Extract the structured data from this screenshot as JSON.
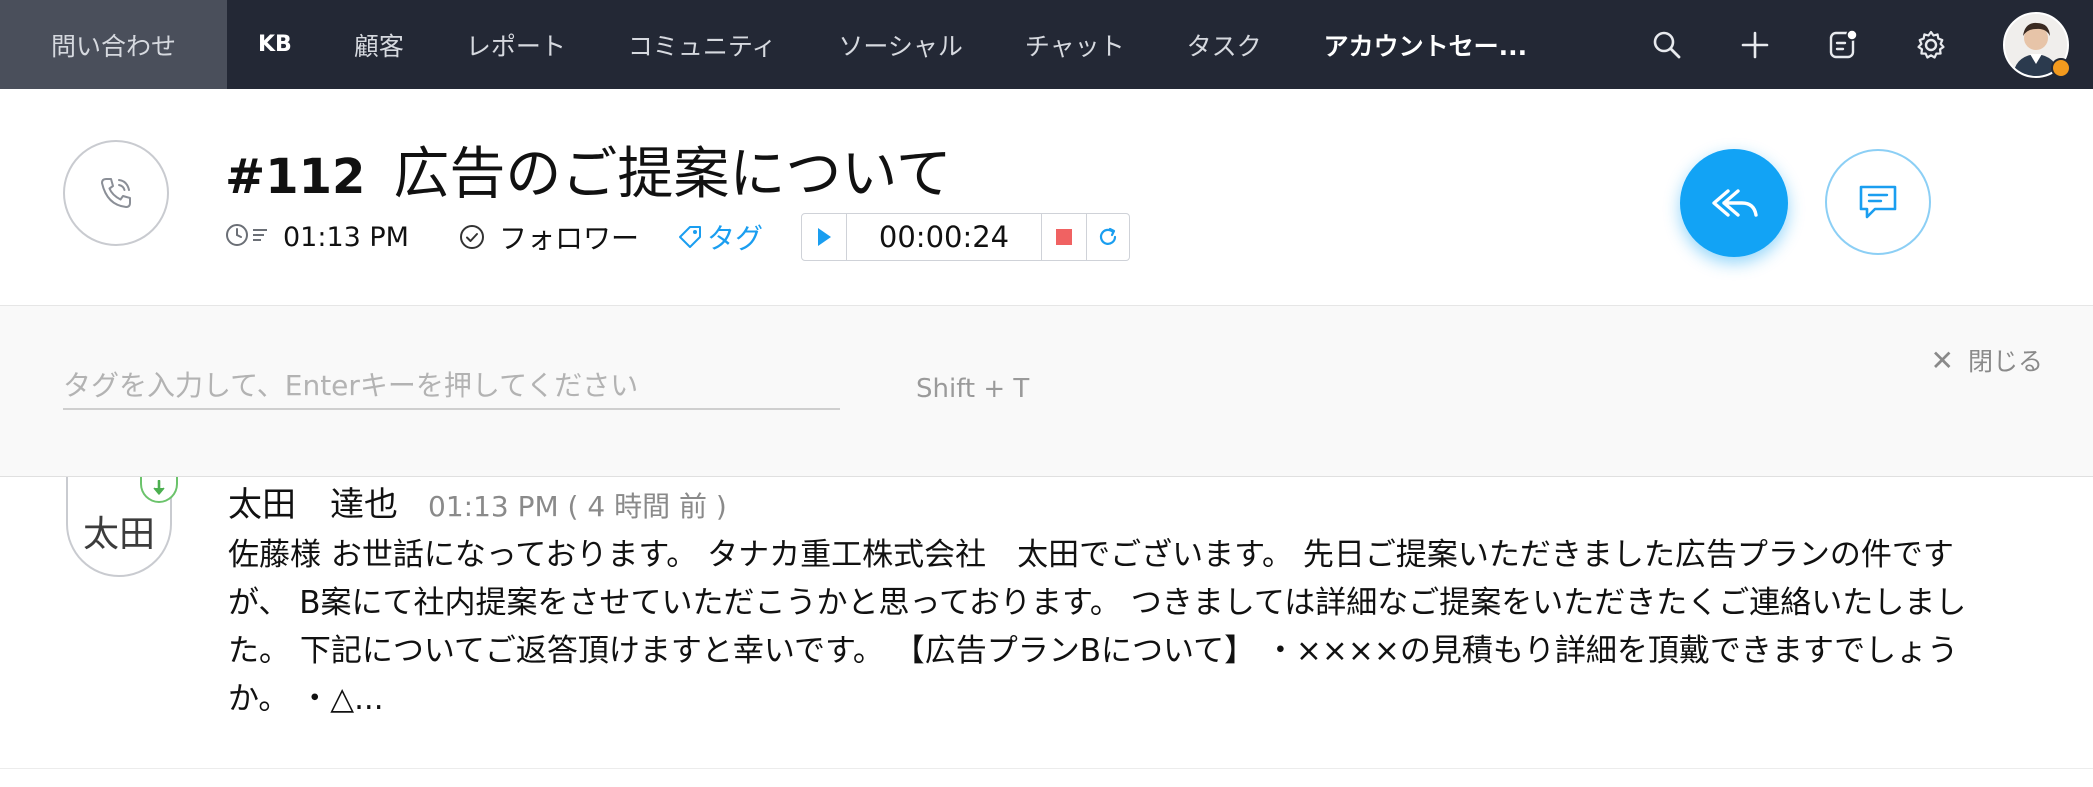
{
  "nav": {
    "items": [
      {
        "label": "問い合わせ",
        "active": true
      },
      {
        "label": "KB"
      },
      {
        "label": "顧客"
      },
      {
        "label": "レポート"
      },
      {
        "label": "コミュニティ"
      },
      {
        "label": "ソーシャル"
      },
      {
        "label": "チャット"
      },
      {
        "label": "タスク"
      },
      {
        "label": "アカウントセー..."
      }
    ],
    "icons": [
      "search-icon",
      "plus-icon",
      "notification-icon",
      "gear-icon"
    ],
    "status_color": "#f39a1e"
  },
  "ticket": {
    "number": "#112",
    "title": "広告のご提案について",
    "time": "01:13 PM",
    "follower_label": "フォロワー",
    "tag_label": "タグ",
    "timer": "00:00:24"
  },
  "tagbar": {
    "placeholder": "タグを入力して、Enterキーを押してください",
    "shortcut": "Shift + T",
    "close_label": "閉じる"
  },
  "thread": {
    "avatar_text": "太田",
    "sender": "太田　達也",
    "time": "01:13 PM ( 4 時間 前 )",
    "body": "佐藤様 お世話になっております。 タナカ重工株式会社　太田でございます。 先日ご提案いただきました広告プランの件ですが、 B案にて社内提案をさせていただこうかと思っております。 つきましては詳細なご提案をいただきたくご連絡いたしました。 下記についてご返答頂けますと幸いです。 【広告プランBについて】 ・××××の見積もり詳細を頂戴できますでしょうか。 ・△..."
  },
  "colors": {
    "nav_bg": "#232835",
    "accent": "#12a3f5",
    "stop": "#f06262"
  }
}
